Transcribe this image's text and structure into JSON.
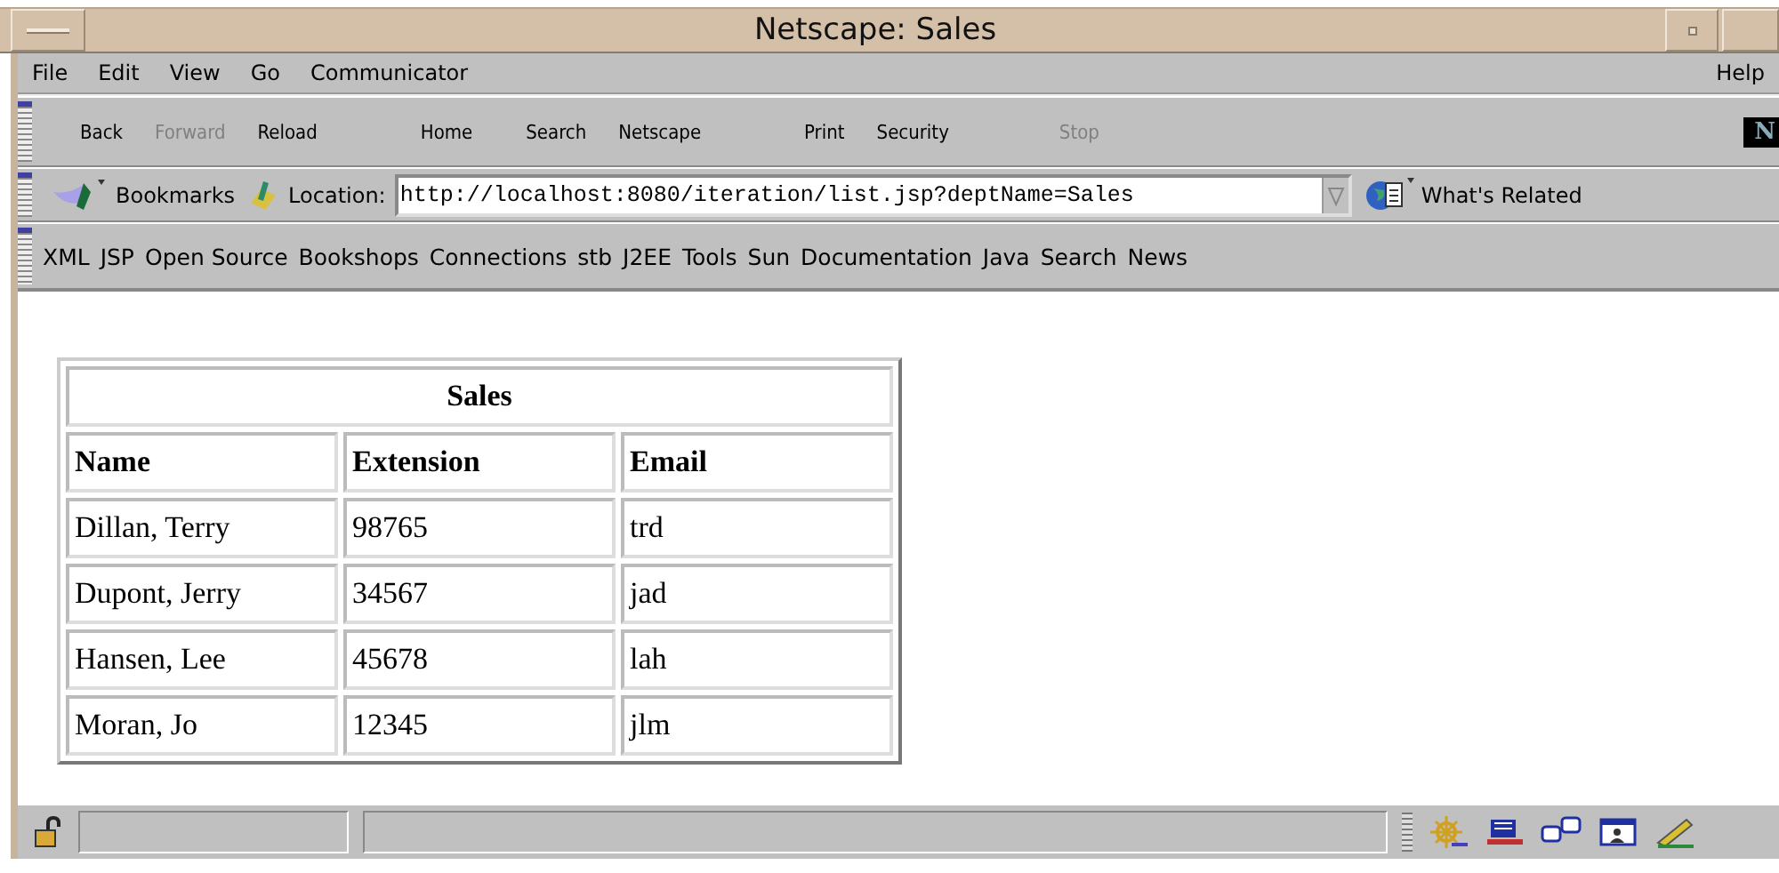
{
  "window": {
    "title": "Netscape: Sales"
  },
  "menu": {
    "items": [
      "File",
      "Edit",
      "View",
      "Go",
      "Communicator"
    ],
    "help": "Help"
  },
  "toolbar": {
    "logo": "N",
    "buttons": [
      {
        "label": "Back",
        "disabled": false
      },
      {
        "label": "Forward",
        "disabled": true
      },
      {
        "label": "Reload",
        "disabled": false
      },
      {
        "label": "Home",
        "disabled": false
      },
      {
        "label": "Search",
        "disabled": false
      },
      {
        "label": "Netscape",
        "disabled": false
      },
      {
        "label": "Print",
        "disabled": false
      },
      {
        "label": "Security",
        "disabled": false
      },
      {
        "label": "Stop",
        "disabled": true
      }
    ]
  },
  "location_bar": {
    "bookmarks": "Bookmarks",
    "label": "Location:",
    "url": "http://localhost:8080/iteration/list.jsp?deptName=Sales",
    "related": "What's Related"
  },
  "personal_toolbar": [
    "XML",
    "JSP",
    "Open Source",
    "Bookshops",
    "Connections",
    "stb",
    "J2EE",
    "Tools",
    "Sun",
    "Documentation",
    "Java",
    "Search",
    "News"
  ],
  "table": {
    "caption": "Sales",
    "columns": [
      "Name",
      "Extension",
      "Email"
    ],
    "rows": [
      [
        "Dillan, Terry",
        "98765",
        "trd"
      ],
      [
        "Dupont, Jerry",
        "34567",
        "jad"
      ],
      [
        "Hansen, Lee",
        "45678",
        "lah"
      ],
      [
        "Moran, Jo",
        "12345",
        "jlm"
      ]
    ]
  }
}
